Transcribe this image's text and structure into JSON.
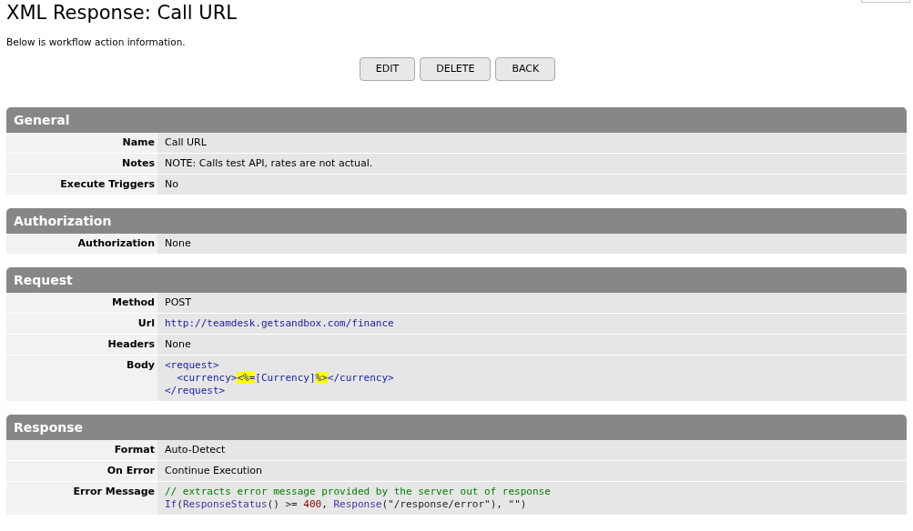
{
  "title": "XML Response: Call URL",
  "subtitle": "Below is workflow action information.",
  "buttons": [
    "EDIT",
    "DELETE",
    "BACK"
  ],
  "sections": [
    {
      "title": "General",
      "rows": [
        {
          "label": "Name",
          "kind": "text",
          "value": "Call URL"
        },
        {
          "label": "Notes",
          "kind": "text",
          "value": "NOTE: Calls test API, rates are not actual."
        },
        {
          "label": "Execute Triggers",
          "kind": "text",
          "value": "No"
        }
      ]
    },
    {
      "title": "Authorization",
      "rows": [
        {
          "label": "Authorization",
          "kind": "text",
          "value": "None"
        }
      ]
    },
    {
      "title": "Request",
      "rows": [
        {
          "label": "Method",
          "kind": "text",
          "value": "POST"
        },
        {
          "label": "Url",
          "kind": "link",
          "value": "http://teamdesk.getsandbox.com/finance"
        },
        {
          "label": "Headers",
          "kind": "text",
          "value": "None"
        },
        {
          "label": "Body",
          "kind": "code",
          "lines": [
            [
              {
                "kind": "tag",
                "text": "<request>"
              }
            ],
            [
              {
                "kind": "tag",
                "text": "  <currency>"
              },
              {
                "kind": "highlight",
                "text": "<%="
              },
              {
                "kind": "tag",
                "text": "[Currency]"
              },
              {
                "kind": "highlight",
                "text": "%>"
              },
              {
                "kind": "tag",
                "text": "</currency>"
              }
            ],
            [
              {
                "kind": "tag",
                "text": "</request>"
              }
            ]
          ]
        }
      ]
    },
    {
      "title": "Response",
      "rows": [
        {
          "label": "Format",
          "kind": "text",
          "value": "Auto-Detect"
        },
        {
          "label": "On Error",
          "kind": "text",
          "value": "Continue Execution"
        },
        {
          "label": "Error Message",
          "kind": "code",
          "lines": [
            [
              {
                "kind": "comment",
                "text": "// extracts error message provided by the server out of response"
              }
            ],
            [
              {
                "kind": "func",
                "text": "If"
              },
              {
                "kind": "plain",
                "text": "("
              },
              {
                "kind": "func",
                "text": "ResponseStatus"
              },
              {
                "kind": "plain",
                "text": "() >= "
              },
              {
                "kind": "number",
                "text": "400"
              },
              {
                "kind": "plain",
                "text": ", "
              },
              {
                "kind": "func",
                "text": "Response"
              },
              {
                "kind": "plain",
                "text": "(\"/response/error\"), \"\")"
              }
            ]
          ]
        }
      ]
    }
  ]
}
